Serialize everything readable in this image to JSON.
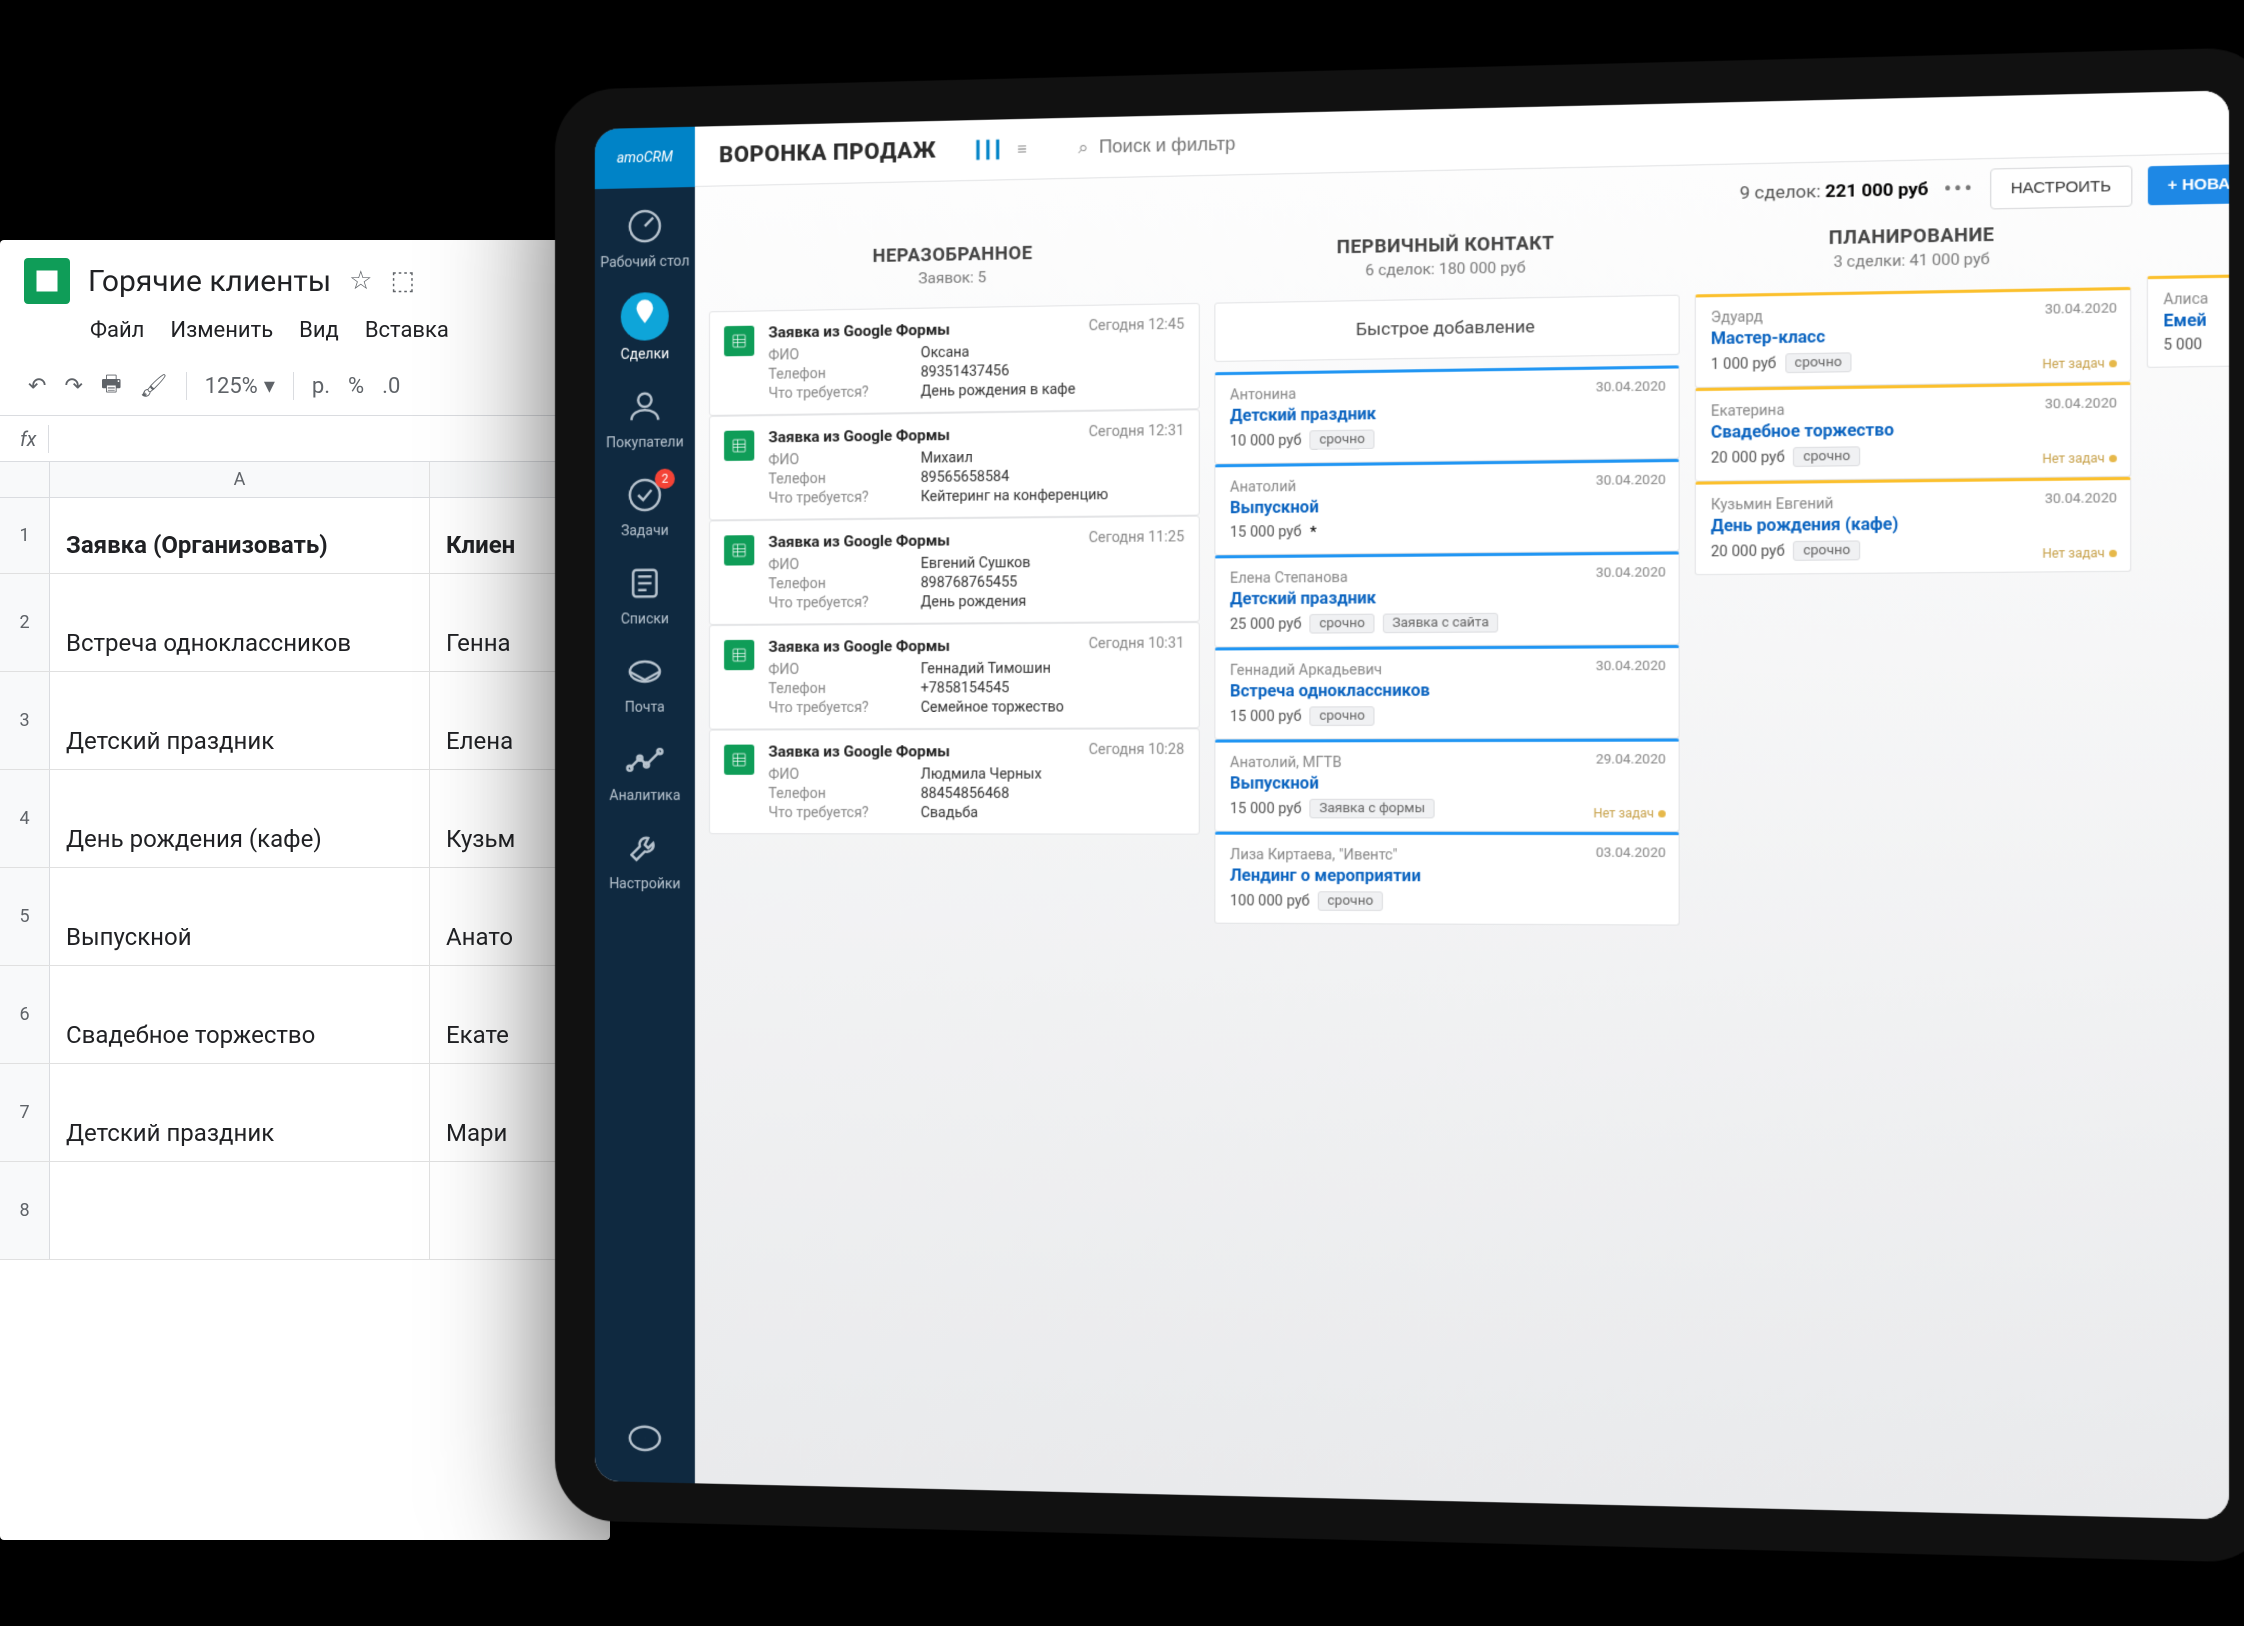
{
  "sheets": {
    "title": "Горячие клиенты",
    "menu": [
      "Файл",
      "Изменить",
      "Вид",
      "Вставка"
    ],
    "zoom": "125%",
    "currency_symbol": "р.",
    "percent_symbol": "%",
    "decimal_symbol": ".0",
    "columns": [
      "A"
    ],
    "header_row": {
      "a": "Заявка (Организовать)",
      "b": "Клиен"
    },
    "rows": [
      {
        "n": "2",
        "a": "Встреча одноклассников",
        "b": "Генна"
      },
      {
        "n": "3",
        "a": "Детский праздник",
        "b": "Елена"
      },
      {
        "n": "4",
        "a": "День рождения (кафе)",
        "b": "Кузьм"
      },
      {
        "n": "5",
        "a": "Выпускной",
        "b": "Анато"
      },
      {
        "n": "6",
        "a": "Свадебное торжество",
        "b": "Екате"
      },
      {
        "n": "7",
        "a": "Детский праздник",
        "b": "Мари"
      },
      {
        "n": "8",
        "a": "",
        "b": ""
      }
    ]
  },
  "crm": {
    "brand": "amoCRM",
    "nav": [
      {
        "label": "Рабочий стол"
      },
      {
        "label": "Сделки",
        "active": true
      },
      {
        "label": "Покупатели"
      },
      {
        "label": "Задачи",
        "badge": "2"
      },
      {
        "label": "Списки"
      },
      {
        "label": "Почта"
      },
      {
        "label": "Аналитика"
      },
      {
        "label": "Настройки"
      }
    ],
    "title": "ВОРОНКА ПРОДАЖ",
    "search_placeholder": "Поиск и фильтр",
    "summary_deals": "9 сделок:",
    "summary_amount": "221 000 руб",
    "btn_configure": "НАСТРОИТЬ",
    "btn_new": "+ НОВАЯ",
    "columns": [
      {
        "name": "НЕРАЗОБРАННОЕ",
        "sub": "Заявок: 5",
        "leads": [
          {
            "title": "Заявка из Google Формы",
            "time": "Сегодня 12:45",
            "fields": [
              [
                "ФИО",
                "Оксана"
              ],
              [
                "Телефон",
                "89351437456"
              ],
              [
                "Что требуется?",
                "День рождения в кафе"
              ]
            ]
          },
          {
            "title": "Заявка из Google Формы",
            "time": "Сегодня 12:31",
            "fields": [
              [
                "ФИО",
                "Михаил"
              ],
              [
                "Телефон",
                "89565658584"
              ],
              [
                "Что требуется?",
                "Кейтеринг на конференцию"
              ]
            ]
          },
          {
            "title": "Заявка из Google Формы",
            "time": "Сегодня 11:25",
            "fields": [
              [
                "ФИО",
                "Евгений Сушков"
              ],
              [
                "Телефон",
                "898768765455"
              ],
              [
                "Что требуется?",
                "День рождения"
              ]
            ]
          },
          {
            "title": "Заявка из Google Формы",
            "time": "Сегодня 10:31",
            "fields": [
              [
                "ФИО",
                "Геннадий Тимошин"
              ],
              [
                "Телефон",
                "+7858154545"
              ],
              [
                "Что требуется?",
                "Семейное торжество"
              ]
            ]
          },
          {
            "title": "Заявка из Google Формы",
            "time": "Сегодня 10:28",
            "fields": [
              [
                "ФИО",
                "Людмила Черных"
              ],
              [
                "Телефон",
                "88454856468"
              ],
              [
                "Что требуется?",
                "Свадьба"
              ]
            ]
          }
        ]
      },
      {
        "name": "ПЕРВИЧНЫЙ КОНТАКТ",
        "sub": "6 сделок: 180 000 руб",
        "quick_add": "Быстрое добавление",
        "deals": [
          {
            "contact": "Антонина",
            "date": "30.04.2020",
            "name": "Детский праздник",
            "price": "10 000 руб",
            "chips": [
              "срочно"
            ]
          },
          {
            "contact": "Анатолий",
            "date": "30.04.2020",
            "name": "Выпускной",
            "price": "15 000 руб",
            "star": "*"
          },
          {
            "contact": "Елена Степанова",
            "date": "30.04.2020",
            "name": "Детский праздник",
            "price": "25 000 руб",
            "chips": [
              "срочно",
              "Заявка с сайта"
            ]
          },
          {
            "contact": "Геннадий Аркадьевич",
            "date": "30.04.2020",
            "name": "Встреча одноклассников",
            "price": "15 000 руб",
            "chips": [
              "срочно"
            ]
          },
          {
            "contact": "Анатолий, МГТВ",
            "date": "29.04.2020",
            "name": "Выпускной",
            "price": "15 000 руб",
            "chips": [
              "Заявка с формы"
            ],
            "no_task": "Нет задач"
          },
          {
            "contact": "Лиза Киртаева, \"Ивентс\"",
            "date": "03.04.2020",
            "name": "Лендинг о мероприятии",
            "price": "100 000 руб",
            "chips": [
              "срочно"
            ]
          }
        ]
      },
      {
        "name": "ПЛАНИРОВАНИЕ",
        "sub": "3 сделки: 41 000 руб",
        "deals": [
          {
            "contact": "Эдуард",
            "date": "30.04.2020",
            "name": "Мастер-класс",
            "price": "1 000 руб",
            "chips": [
              "срочно"
            ],
            "no_task": "Нет задач"
          },
          {
            "contact": "Екатерина",
            "date": "30.04.2020",
            "name": "Свадебное торжество",
            "price": "20 000 руб",
            "chips": [
              "срочно"
            ],
            "no_task": "Нет задач"
          },
          {
            "contact": "Кузьмин Евгений",
            "date": "30.04.2020",
            "name": "День рождения (кафе)",
            "price": "20 000 руб",
            "chips": [
              "срочно"
            ],
            "no_task": "Нет задач"
          }
        ]
      },
      {
        "partial": true,
        "deals": [
          {
            "contact": "Алиса",
            "name": "Емей",
            "price": "5 000"
          }
        ]
      }
    ]
  }
}
